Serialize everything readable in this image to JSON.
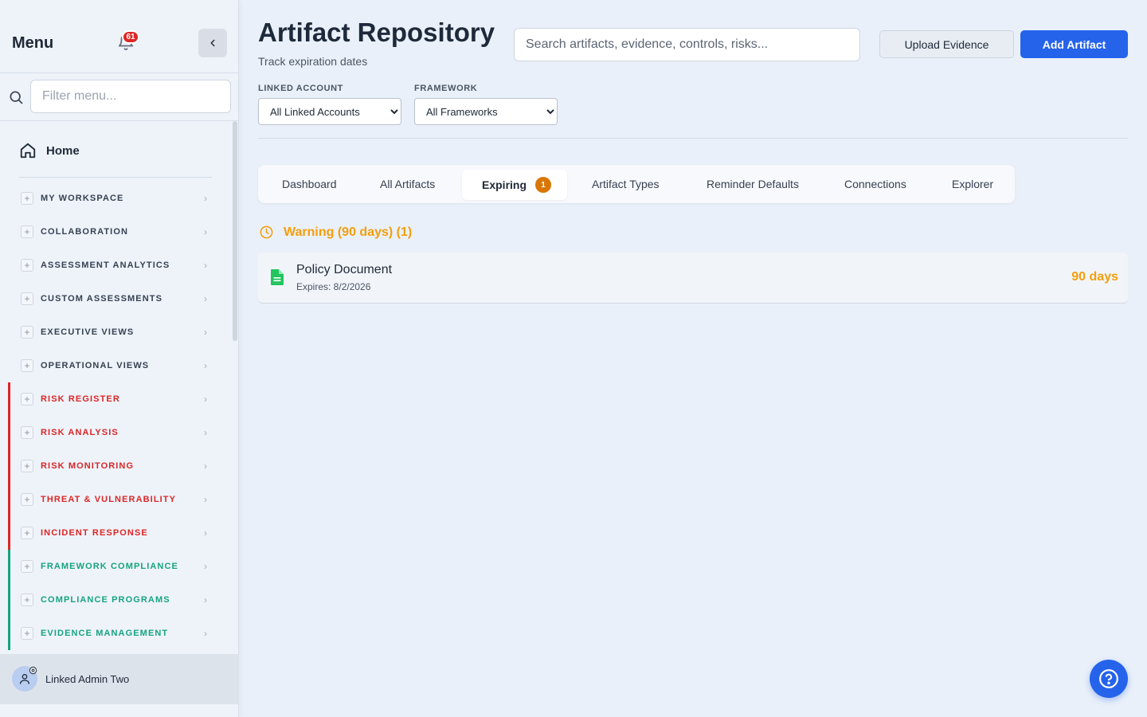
{
  "sidebar": {
    "title": "Menu",
    "notification_count": "61",
    "filter_placeholder": "Filter menu...",
    "home_label": "Home",
    "items": [
      {
        "label": "MY WORKSPACE",
        "color": "#374151",
        "accent": ""
      },
      {
        "label": "COLLABORATION",
        "color": "#374151",
        "accent": ""
      },
      {
        "label": "ASSESSMENT ANALYTICS",
        "color": "#374151",
        "accent": ""
      },
      {
        "label": "CUSTOM ASSESSMENTS",
        "color": "#374151",
        "accent": ""
      },
      {
        "label": "EXECUTIVE VIEWS",
        "color": "#374151",
        "accent": ""
      },
      {
        "label": "OPERATIONAL VIEWS",
        "color": "#374151",
        "accent": ""
      },
      {
        "label": "RISK REGISTER",
        "color": "#dc2626",
        "accent": "#dc2626"
      },
      {
        "label": "RISK ANALYSIS",
        "color": "#dc2626",
        "accent": "#dc2626"
      },
      {
        "label": "RISK MONITORING",
        "color": "#dc2626",
        "accent": "#dc2626"
      },
      {
        "label": "THREAT & VULNERABILITY",
        "color": "#dc2626",
        "accent": "#dc2626"
      },
      {
        "label": "INCIDENT RESPONSE",
        "color": "#dc2626",
        "accent": "#dc2626"
      },
      {
        "label": "FRAMEWORK COMPLIANCE",
        "color": "#16a37f",
        "accent": "#16a37f"
      },
      {
        "label": "COMPLIANCE PROGRAMS",
        "color": "#16a37f",
        "accent": "#16a37f"
      },
      {
        "label": "EVIDENCE MANAGEMENT",
        "color": "#16a37f",
        "accent": "#16a37f"
      }
    ],
    "user_name": "Linked Admin Two"
  },
  "header": {
    "title": "Artifact Repository",
    "subtitle": "Track expiration dates",
    "search_placeholder": "Search artifacts, evidence, controls, risks...",
    "upload_label": "Upload Evidence",
    "add_label": "Add Artifact"
  },
  "filters": {
    "linked_account_label": "LINKED ACCOUNT",
    "linked_account_value": "All Linked Accounts",
    "framework_label": "FRAMEWORK",
    "framework_value": "All Frameworks"
  },
  "tabs": [
    {
      "label": "Dashboard"
    },
    {
      "label": "All Artifacts"
    },
    {
      "label": "Expiring",
      "badge": "1",
      "active": true
    },
    {
      "label": "Artifact Types"
    },
    {
      "label": "Reminder Defaults"
    },
    {
      "label": "Connections"
    },
    {
      "label": "Explorer"
    }
  ],
  "expiring": {
    "section_title": "Warning (90 days) (1)",
    "items": [
      {
        "name": "Policy Document",
        "expires": "Expires: 8/2/2026",
        "days": "90 days"
      }
    ]
  },
  "colors": {
    "primary": "#2563eb",
    "warning": "#f59e0b",
    "risk": "#dc2626",
    "compliance": "#16a37f"
  }
}
